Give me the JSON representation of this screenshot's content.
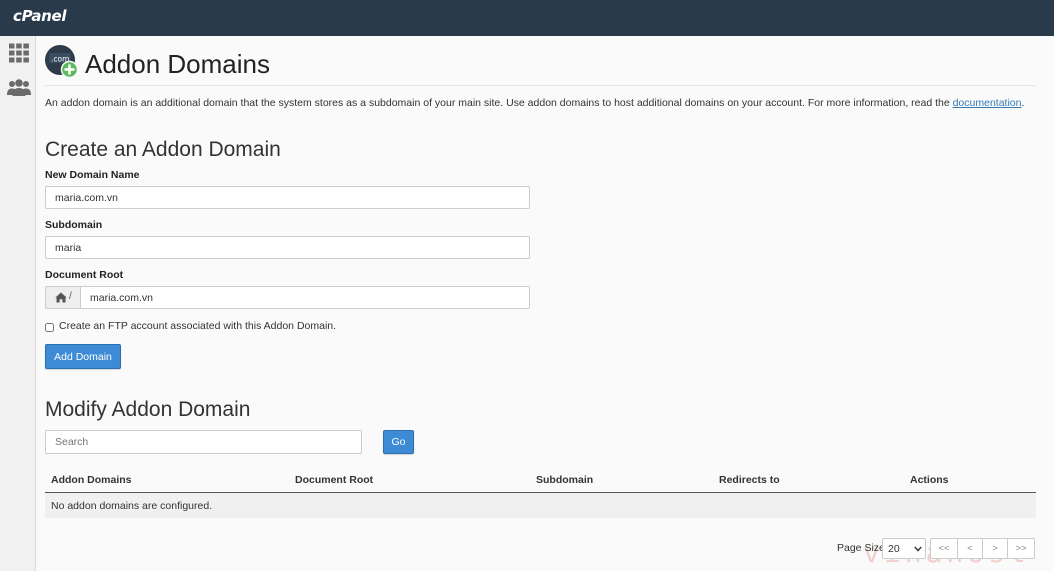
{
  "app": {
    "logo_text": "cPanel"
  },
  "sidebar": {
    "items": [
      {
        "icon": "grid-icon"
      },
      {
        "icon": "users-icon"
      }
    ]
  },
  "header": {
    "title": "Addon Domains",
    "icon": "addon-domain-icon"
  },
  "intro": {
    "text": "An addon domain is an additional domain that the system stores as a subdomain of your main site. Use addon domains to host additional domains on your account. For more information, read the ",
    "link": "documentation",
    "end": "."
  },
  "create": {
    "heading": "Create an Addon Domain",
    "new_domain": {
      "label": "New Domain Name",
      "value": "maria.com.vn"
    },
    "subdomain": {
      "label": "Subdomain",
      "value": "maria"
    },
    "docroot": {
      "label": "Document Root",
      "prefix": "/",
      "value": "maria.com.vn"
    },
    "ftp_checkbox": {
      "label": "Create an FTP account associated with this Addon Domain.",
      "checked": false
    },
    "submit_label": "Add Domain"
  },
  "modify": {
    "heading": "Modify Addon Domain",
    "search": {
      "placeholder": "Search"
    },
    "go_label": "Go",
    "table": {
      "columns": [
        "Addon Domains",
        "Document Root",
        "Subdomain",
        "Redirects to",
        "Actions"
      ],
      "empty_message": "No addon domains are configured."
    },
    "pagination": {
      "page_size_label": "Page Size",
      "page_size": "20",
      "first": "<<",
      "prev": "<",
      "next": ">",
      "last": ">>"
    }
  },
  "watermark": {
    "text": "vinahost"
  },
  "colors": {
    "topbar": "#293a4a",
    "primary": "#3d8bd5",
    "link": "#337ab7",
    "watermark": "#d63a2a"
  }
}
